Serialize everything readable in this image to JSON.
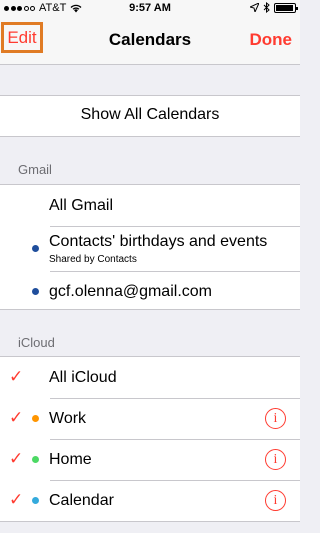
{
  "status_bar": {
    "carrier": "AT&T",
    "time": "9:57 AM",
    "signal_icon": "signal-dots-icon",
    "wifi_icon": "wifi-icon",
    "location_icon": "location-arrow-icon",
    "bluetooth_icon": "bluetooth-icon",
    "battery_icon": "battery-icon",
    "battery_level": 0.95
  },
  "nav": {
    "edit_label": "Edit",
    "title": "Calendars",
    "done_label": "Done"
  },
  "show_all_label": "Show All Calendars",
  "groups": [
    {
      "header": "Gmail",
      "items": [
        {
          "label": "All Gmail",
          "subtitle": "",
          "checked": false,
          "dot_color": "",
          "info": false
        },
        {
          "label": "Contacts' birthdays and events",
          "subtitle": "Shared by Contacts",
          "checked": false,
          "dot_color": "#1f4e9c",
          "info": false
        },
        {
          "label": "gcf.olenna@gmail.com",
          "subtitle": "",
          "checked": false,
          "dot_color": "#1f4e9c",
          "info": false
        }
      ]
    },
    {
      "header": "iCloud",
      "items": [
        {
          "label": "All iCloud",
          "subtitle": "",
          "checked": true,
          "dot_color": "",
          "info": false
        },
        {
          "label": "Work",
          "subtitle": "",
          "checked": true,
          "dot_color": "#ff9500",
          "info": true
        },
        {
          "label": "Home",
          "subtitle": "",
          "checked": true,
          "dot_color": "#4cd964",
          "info": true
        },
        {
          "label": "Calendar",
          "subtitle": "",
          "checked": true,
          "dot_color": "#34aadc",
          "info": true
        }
      ]
    }
  ],
  "check_glyph": "✓",
  "info_glyph": "i",
  "colors": {
    "accent": "#ff3b30",
    "highlight_border": "#e07b24"
  }
}
